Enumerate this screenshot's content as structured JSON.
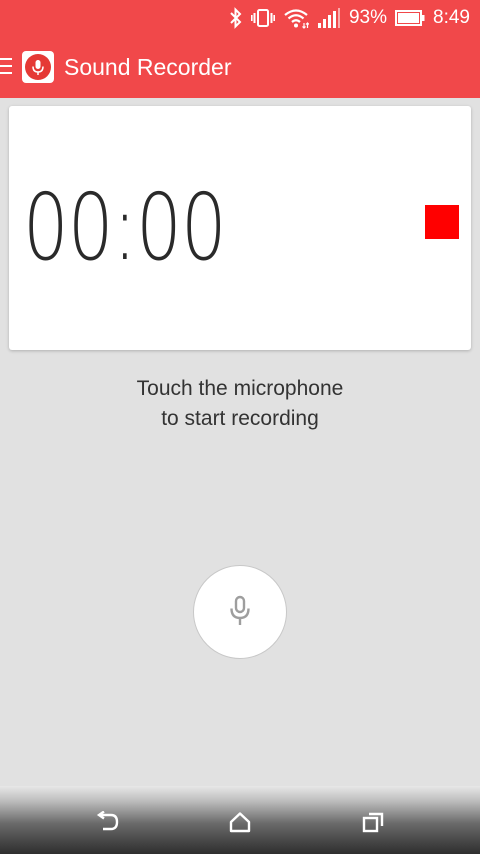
{
  "status_bar": {
    "battery": "93%",
    "time": "8:49",
    "icons": [
      "bluetooth-icon",
      "vibrate-icon",
      "wifi-icon",
      "signal-icon",
      "battery-icon"
    ]
  },
  "app_bar": {
    "title": "Sound Recorder",
    "icons": [
      "menu-icon",
      "sound-recorder-logo-icon"
    ]
  },
  "recorder": {
    "timer": "00:00",
    "stop_icon": "stop-icon",
    "hint_line1": "Touch the microphone",
    "hint_line2": "to start recording",
    "record_icon": "microphone-icon"
  },
  "navigation": {
    "icons": [
      "back-icon",
      "home-icon",
      "recent-apps-icon"
    ]
  },
  "colors": {
    "app_bar": "#f1484a",
    "background": "#e1e1e1",
    "stop": "#ff0000"
  }
}
